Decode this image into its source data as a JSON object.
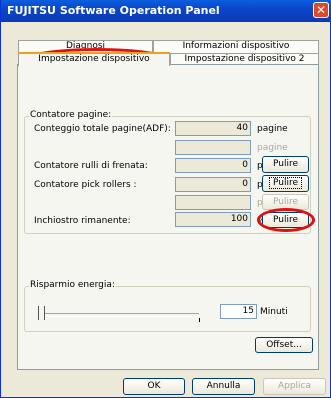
{
  "window": {
    "title": "FUJITSU Software Operation Panel",
    "close_icon": "close-icon"
  },
  "tabs": {
    "row1": [
      "Diagnosi",
      "Informazioni dispositivo"
    ],
    "row2": [
      "Impostazione dispositivo",
      "Impostazione dispositivo 2"
    ],
    "active": "Impostazione dispositivo"
  },
  "counter": {
    "group_label": "Contatore pagine:",
    "total_label": "Conteggio totale pagine(ADF):",
    "total_value": "40",
    "total_unit": "pagine",
    "blank_unit": "pagine",
    "brake_label": "Contatore rulli di frenata:",
    "brake_value": "0",
    "brake_unit": "pagine",
    "brake_button": "Pulire",
    "pick_label": "Contatore pick rollers :",
    "pick_value": "0",
    "pick_unit": "pagine",
    "pick_button": "Pulire",
    "blank2_unit": "pagine",
    "blank2_button": "Pulire",
    "ink_label": "Inchiostro rimanente:",
    "ink_value": "100",
    "ink_unit": "%",
    "ink_button": "Pulire"
  },
  "energy": {
    "group_label": "Risparmio energia:",
    "value": "15",
    "unit": "Minuti"
  },
  "offset_button": "Offset...",
  "footer": {
    "ok": "OK",
    "cancel": "Annulla",
    "apply": "Applica"
  },
  "colors": {
    "highlight_oval": "#e01010",
    "title_bar": "#0a46c8"
  }
}
